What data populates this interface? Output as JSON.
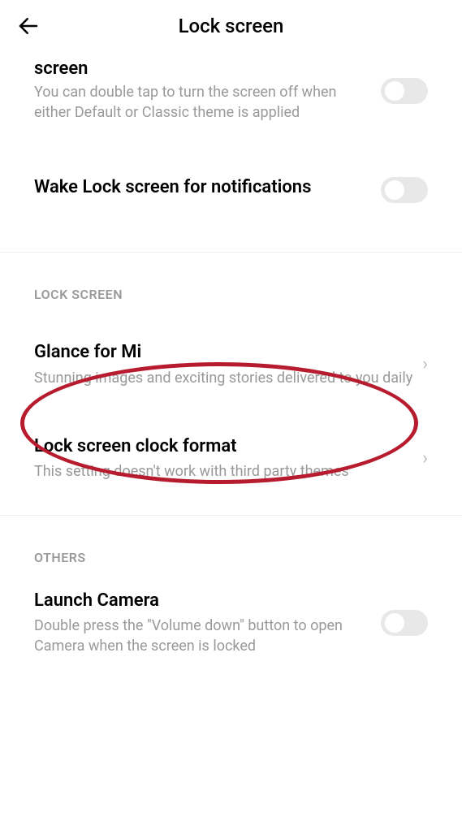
{
  "header": {
    "title": "Lock screen"
  },
  "items": {
    "doubleTap": {
      "truncatedTitle": "screen",
      "desc": "You can double tap to turn the screen off when either Default or Classic theme is applied"
    },
    "wakeLock": {
      "title": "Wake Lock screen for notifications"
    },
    "glance": {
      "title": "Glance for Mi",
      "desc": "Stunning images and exciting stories delivered to you daily"
    },
    "clockFormat": {
      "title": "Lock screen clock format",
      "desc": "This setting doesn't work with third party themes"
    },
    "launchCamera": {
      "title": "Launch Camera",
      "desc": "Double press the \"Volume down\" button to open Camera when the screen is locked"
    }
  },
  "sections": {
    "lockScreen": "LOCK SCREEN",
    "others": "OTHERS"
  }
}
